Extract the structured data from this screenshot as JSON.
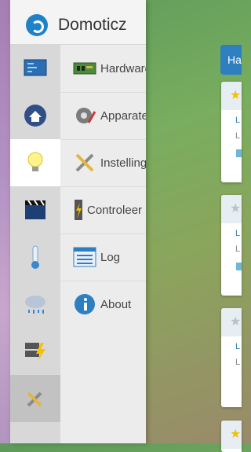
{
  "app": {
    "title": "Domoticz"
  },
  "menu": {
    "items": [
      {
        "label": "Hardware",
        "icon": "hardware-icon"
      },
      {
        "label": "Apparaten",
        "icon": "devices-gear-icon"
      },
      {
        "label": "Instellingen",
        "icon": "settings-tools-icon"
      },
      {
        "label": "Controleer",
        "icon": "check-power-icon"
      },
      {
        "label": "Log",
        "icon": "log-list-icon"
      },
      {
        "label": "About",
        "icon": "info-icon"
      }
    ],
    "sidebar_icons": [
      "dashboard-icon",
      "floorplan-icon",
      "lights-icon",
      "scenes-icon",
      "temperature-icon",
      "weather-icon",
      "utility-icon",
      "setup-icon"
    ]
  },
  "background": {
    "panel_button": "Ha",
    "cards": [
      {
        "star": "★",
        "starred": true,
        "lines": [
          "L",
          "L"
        ],
        "has_bar": true
      },
      {
        "star": "★",
        "starred": false,
        "lines": [
          "L",
          "L"
        ],
        "has_bar": true
      },
      {
        "star": "★",
        "starred": false,
        "lines": [
          "L",
          "L"
        ],
        "has_bar": false
      },
      {
        "star": "★",
        "starred": true,
        "lines": [],
        "has_bar": false
      }
    ]
  },
  "colors": {
    "accent": "#2e7fc0",
    "menu_bg": "#ececec",
    "active_bg": "#ffffff"
  }
}
